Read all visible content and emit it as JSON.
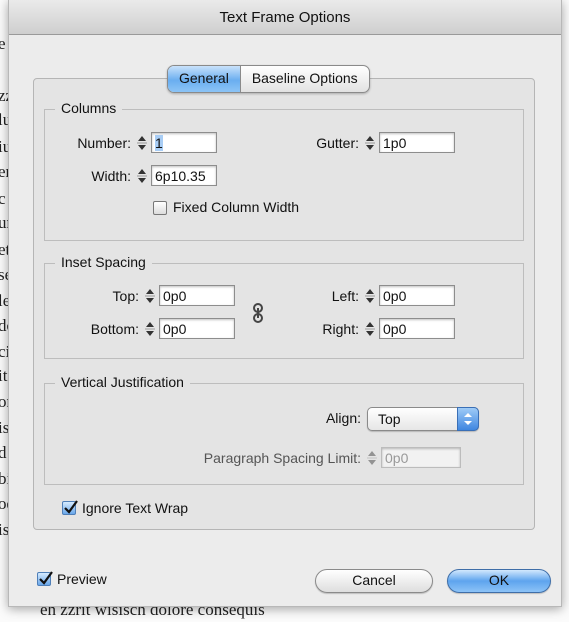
{
  "background_text": [
    "e",
    "zz",
    "lu",
    "iu",
    "er",
    "c",
    "un",
    "et",
    "se",
    "le",
    "do",
    "ci",
    "it,",
    "on",
    "is",
    "d r",
    "bis",
    "od",
    "is",
    "eh zzrit wisisch dolore consequis"
  ],
  "dialog": {
    "title": "Text Frame Options"
  },
  "tabs": [
    {
      "label": "General",
      "active": true
    },
    {
      "label": "Baseline Options",
      "active": false
    }
  ],
  "columns": {
    "legend": "Columns",
    "number_label": "Number:",
    "number_value": "1",
    "gutter_label": "Gutter:",
    "gutter_value": "1p0",
    "width_label": "Width:",
    "width_value": "6p10.35",
    "fixed_label": "Fixed Column Width",
    "fixed_checked": false
  },
  "inset": {
    "legend": "Inset Spacing",
    "top_label": "Top:",
    "top_value": "0p0",
    "bottom_label": "Bottom:",
    "bottom_value": "0p0",
    "left_label": "Left:",
    "left_value": "0p0",
    "right_label": "Right:",
    "right_value": "0p0",
    "chain_icon": "chain-link-icon"
  },
  "vertical": {
    "legend": "Vertical Justification",
    "align_label": "Align:",
    "align_value": "Top",
    "spacing_label": "Paragraph Spacing Limit:",
    "spacing_value": "0p0"
  },
  "ignore_wrap": {
    "label": "Ignore Text Wrap",
    "checked": true
  },
  "preview": {
    "label": "Preview",
    "checked": true
  },
  "buttons": {
    "cancel": "Cancel",
    "ok": "OK"
  },
  "colors": {
    "accent": "#6aaef0",
    "dialog_bg": "#ececec"
  }
}
